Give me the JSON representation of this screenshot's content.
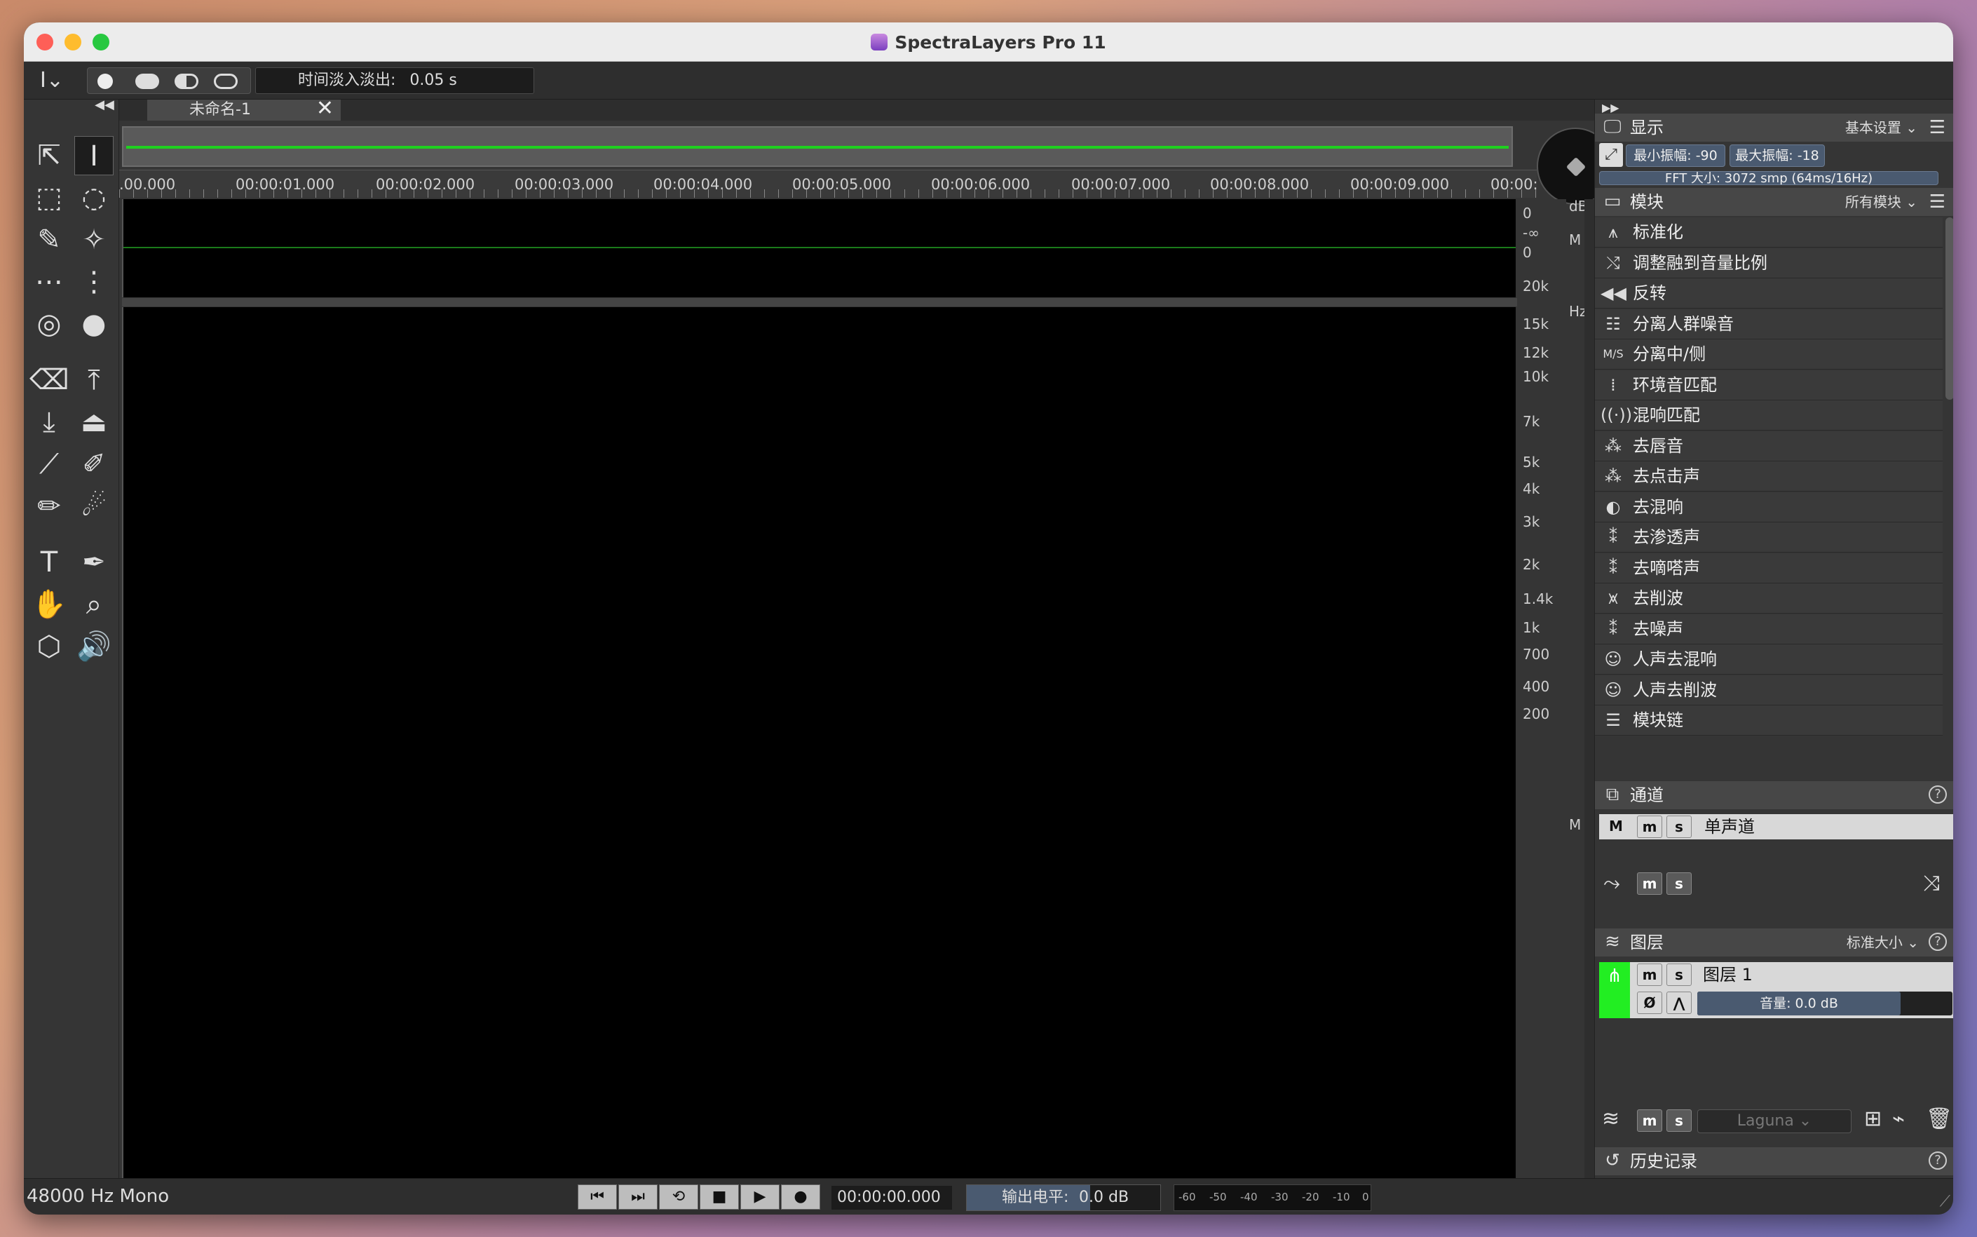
{
  "window": {
    "title": "SpectraLayers Pro 11"
  },
  "toolbar": {
    "fade_label": "时间淡入淡出:",
    "fade_value": "0.05 s"
  },
  "document": {
    "tab_name": "未命名-1"
  },
  "ruler_ticks": [
    ".00.000",
    "00:00:01.000",
    "00:00:02.000",
    "00:00:03.000",
    "00:00:04.000",
    "00:00:05.000",
    "00:00:06.000",
    "00:00:07.000",
    "00:00:08.000",
    "00:00:09.000",
    "00:00:"
  ],
  "wave_scale": {
    "top": "0",
    "mid": "-∞",
    "bottom": "0",
    "unit": "dB",
    "m": "M"
  },
  "freq_scale": {
    "unit": "Hz",
    "m": "M",
    "labels": [
      "20k",
      "15k",
      "12k",
      "10k",
      "7k",
      "5k",
      "4k",
      "3k",
      "2k",
      "1.4k",
      "1k",
      "700",
      "400",
      "200"
    ]
  },
  "display_panel": {
    "title": "显示",
    "preset": "基本设置",
    "min_amp_label": "最小振幅:",
    "min_amp_value": "-90 dB",
    "max_amp_label": "最大振幅:",
    "max_amp_value": "-18 dB",
    "fft_label": "FFT 大小:",
    "fft_value": "3072 smp (64ms/16Hz)"
  },
  "modules_panel": {
    "title": "模块",
    "filter": "所有模块",
    "items": [
      "标准化",
      "调整融到音量比例",
      "反转",
      "分离人群噪音",
      "分离中/侧",
      "环境音匹配",
      "混响匹配",
      "去唇音",
      "去点击声",
      "去混响",
      "去渗透声",
      "去嘀嗒声",
      "去削波",
      "去噪声",
      "人声去混响",
      "人声去削波",
      "模块链"
    ],
    "icons": [
      "normalize-icon",
      "blend-icon",
      "reverse-icon",
      "crowd-icon",
      "mid-side-icon",
      "ambience-icon",
      "reverb-match-icon",
      "de-lip-icon",
      "de-click-icon",
      "de-reverb-icon",
      "de-bleed-icon",
      "de-tick-icon",
      "de-clip-icon",
      "de-noise-icon",
      "voice-de-reverb-icon",
      "voice-de-clip-icon",
      "module-chain-icon"
    ]
  },
  "channels_panel": {
    "title": "通道",
    "help": "?",
    "channel_name": "单声道",
    "m": "M",
    "mute": "m",
    "solo": "s"
  },
  "layers_panel": {
    "title": "图层",
    "size": "标准大小",
    "help": "?",
    "layer_name": "图层 1",
    "volume_label": "音量:",
    "volume_value": "0.0 dB",
    "mute": "m",
    "solo": "s",
    "blend": "Laguna"
  },
  "history_panel": {
    "title": "历史记录",
    "help": "?"
  },
  "status": {
    "format": "48000 Hz Mono",
    "time": "00:00:00.000",
    "output_label": "输出电平:",
    "output_value": "0.0 dB",
    "meter_labels": [
      "-60",
      "-50",
      "-40",
      "-30",
      "-20",
      "-10",
      "0"
    ]
  },
  "colors": {
    "waveform": "#1fd11f",
    "layer_color": "#22ee22",
    "accent": "#4a5a70"
  }
}
